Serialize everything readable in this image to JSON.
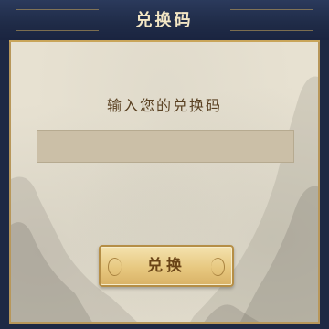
{
  "header": {
    "title": "兑换码"
  },
  "main": {
    "prompt": "输入您的兑换码",
    "code_input": {
      "value": "",
      "placeholder": ""
    },
    "redeem_button_label": "兑换"
  },
  "colors": {
    "header_bg": "#1f2b47",
    "gold_trim": "#c9a55a",
    "panel_bg": "#e7e1d1",
    "input_bg": "#cbbfa7",
    "button_gold": "#e7c880",
    "text_brown": "#5a4122"
  }
}
